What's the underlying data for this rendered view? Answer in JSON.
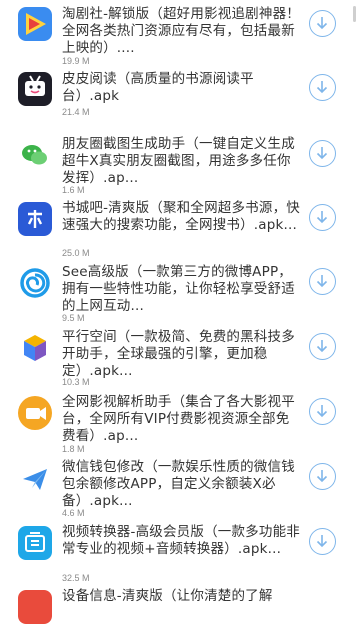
{
  "scroll": {
    "scrollbar": ""
  },
  "apps": [
    {
      "title": "淘剧社-解锁版（超好用影视追剧神器！全网各类热门资源应有尽有，包括最新上映的）....",
      "size": "19.9 M",
      "icon": "play-triangle-icon",
      "color": "#3a8cf0"
    },
    {
      "title": "皮皮阅读（高质量的书源阅读平台）.apk",
      "size": "21.4 M",
      "icon": "reader-face-icon",
      "color": "#1e1e28"
    },
    {
      "title": "朋友圈截图生成助手（一键自定义生成超牛X真实朋友圈截图，用途多多任你发挥）.ap...",
      "size": "1.6 M",
      "icon": "wechat-bubbles-icon",
      "color": "#ffffff"
    },
    {
      "title": "书城吧-清爽版（聚和全网超多书源，快速强大的搜索功能，全网搜书）.apk...",
      "size": "25.0 M",
      "icon": "book-char-icon",
      "color": "#2a5ad6"
    },
    {
      "title": "See高级版（一款第三方的微博APP，拥有一些特性功能，让你轻松享受舒适的上网互动...",
      "size": "9.5 M",
      "icon": "spiral-icon",
      "color": "#ffffff"
    },
    {
      "title": "平行空间（一款极简、免费的黑科技多开助手，全球最强的引擎，更加稳定）.apk...",
      "size": "10.3 M",
      "icon": "parallel-space-icon",
      "color": "#ffffff"
    },
    {
      "title": "全网影视解析助手（集合了各大影视平台，全网所有VIP付费影视资源全部免费看）.ap...",
      "size": "1.8 M",
      "icon": "video-camera-icon",
      "color": "#f5a623"
    },
    {
      "title": "微信钱包修改（一款娱乐性质的微信钱包余额修改APP，自定义余额装X必备）.apk...",
      "size": "4.6 M",
      "icon": "paper-plane-icon",
      "color": "#ffffff"
    },
    {
      "title": "视频转换器-高级会员版（一款多功能非常专业的视频+音频转换器）.apk...",
      "size": "32.5 M",
      "icon": "convert-box-icon",
      "color": "#1ea7e8"
    },
    {
      "title": "设备信息-清爽版（让你清楚的了解",
      "size": "",
      "icon": "device-info-icon",
      "color": "#e94b3c"
    }
  ]
}
